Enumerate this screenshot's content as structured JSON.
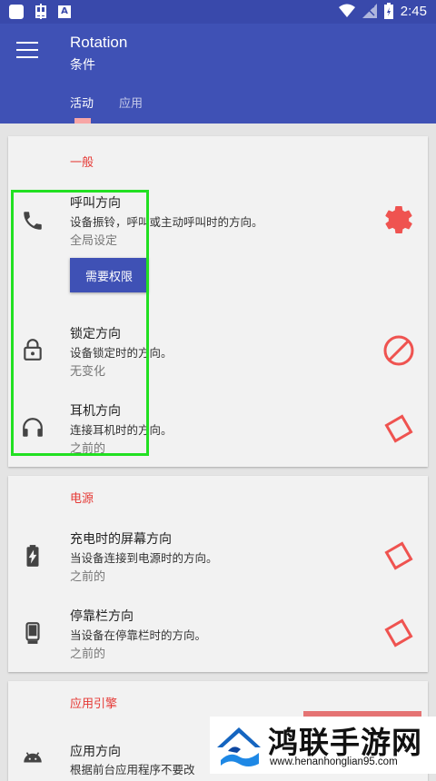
{
  "status_bar": {
    "time": "2:45",
    "icons": [
      "notification-icon",
      "bug-icon",
      "a-icon",
      "wifi-icon",
      "signal-icon",
      "battery-icon"
    ]
  },
  "app_bar": {
    "title": "Rotation",
    "subtitle": "条件",
    "tabs": [
      {
        "label": "活动",
        "active": true
      },
      {
        "label": "应用",
        "active": false
      }
    ]
  },
  "sections": {
    "general": {
      "title": "一般",
      "rows": [
        {
          "icon": "phone-icon",
          "title": "呼叫方向",
          "desc": "设备振铃，呼叫或主动呼叫时的方向。",
          "value": "全局设定",
          "action_icon": "settings-icon",
          "button": "需要权限"
        },
        {
          "icon": "lock-icon",
          "title": "锁定方向",
          "desc": "设备锁定时的方向。",
          "value": "无变化",
          "action_icon": "block-icon"
        },
        {
          "icon": "headphones-icon",
          "title": "耳机方向",
          "desc": "连接耳机时的方向。",
          "value": "之前的",
          "action_icon": "rotation-diamond-icon"
        }
      ]
    },
    "power": {
      "title": "电源",
      "rows": [
        {
          "icon": "battery-charging-icon",
          "title": "充电时的屏幕方向",
          "desc": "当设备连接到电源时的方向。",
          "value": "之前的",
          "action_icon": "rotation-diamond-icon"
        },
        {
          "icon": "dock-icon",
          "title": "停靠栏方向",
          "desc": "当设备在停靠栏时的方向。",
          "value": "之前的",
          "action_icon": "rotation-diamond-icon"
        }
      ]
    },
    "app_engine": {
      "title": "应用引擎",
      "rows": [
        {
          "icon": "android-icon",
          "title": "应用方向",
          "desc": "根据前台应用程序不要改"
        }
      ]
    }
  },
  "watermark": {
    "name": "鸿联手游网",
    "url": "www.henanhonglian95.com"
  },
  "colors": {
    "primary": "#3f51b5",
    "status_bar": "#3949ab",
    "accent_red": "#e53935",
    "action_red": "#ef5350",
    "highlight_green": "#22e022"
  }
}
